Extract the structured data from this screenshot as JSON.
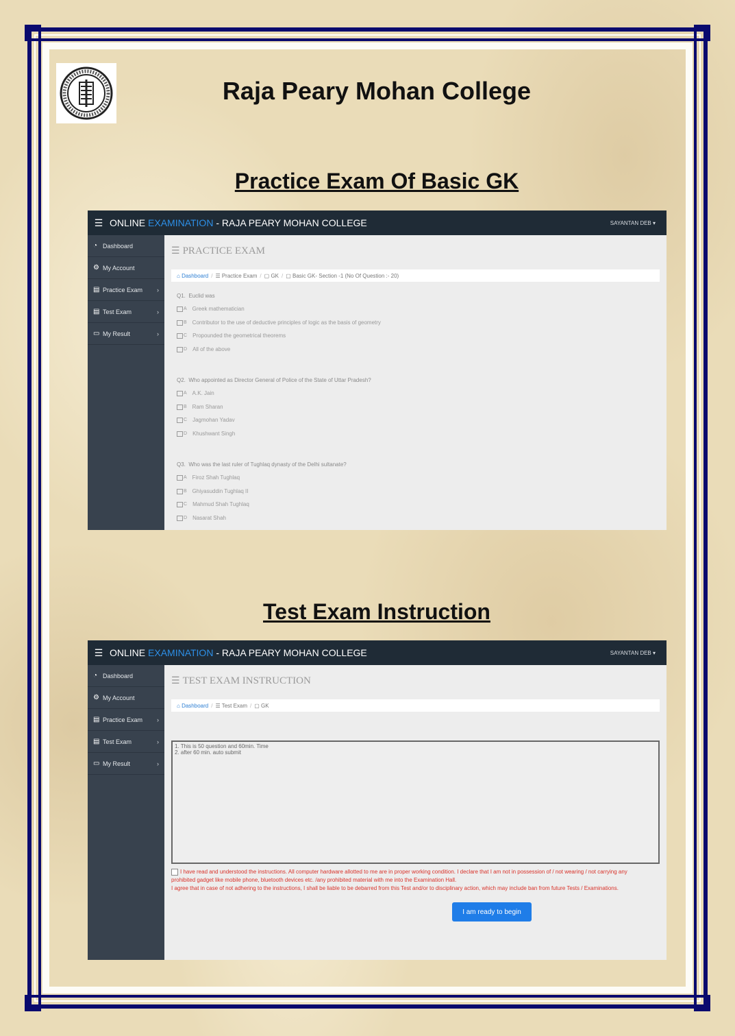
{
  "college_name": "Raja Peary Mohan College",
  "sections": {
    "practice_title": "Practice Exam Of Basic GK",
    "test_title": "Test Exam Instruction"
  },
  "app": {
    "brand_prefix": "ONLINE ",
    "brand_accent": "EXAMINATION",
    "brand_suffix": " - RAJA PEARY MOHAN COLLEGE",
    "user": "SAYANTAN DEB ▾",
    "sidebar": [
      {
        "label": "Dashboard",
        "icon": "dashboard-icon"
      },
      {
        "label": "My Account",
        "icon": "gear-icon"
      },
      {
        "label": "Practice Exam",
        "icon": "list-icon"
      },
      {
        "label": "Test Exam",
        "icon": "list-icon"
      },
      {
        "label": "My Result",
        "icon": "monitor-icon"
      }
    ]
  },
  "practice": {
    "heading": "PRACTICE EXAM",
    "breadcrumb": {
      "home": "Dashboard",
      "c1": "Practice Exam",
      "c2": "GK",
      "c3": "Basic GK- Section -1 (No Of Question :- 20)"
    },
    "questions": [
      {
        "number": "Q1.",
        "text": "Euclid was",
        "options": [
          {
            "letter": "A",
            "text": "Greek mathematician"
          },
          {
            "letter": "B",
            "text": "Contributor to the use of deductive principles of logic as the basis of geometry"
          },
          {
            "letter": "C",
            "text": "Propounded the geometrical theorems"
          },
          {
            "letter": "D",
            "text": "All of the above"
          }
        ]
      },
      {
        "number": "Q2.",
        "text": "Who appointed as Director General of Police of the State of Uttar Pradesh?",
        "options": [
          {
            "letter": "A",
            "text": "A.K. Jain"
          },
          {
            "letter": "B",
            "text": "Ram Sharan"
          },
          {
            "letter": "C",
            "text": "Jagmohan Yadav"
          },
          {
            "letter": "D",
            "text": "Khushwant Singh"
          }
        ]
      },
      {
        "number": "Q3.",
        "text": "Who was the last ruler of Tughlaq dynasty of the Delhi sultanate?",
        "options": [
          {
            "letter": "A",
            "text": "Firoz Shah Tughlaq"
          },
          {
            "letter": "B",
            "text": "Ghiyasuddin Tughlaq II"
          },
          {
            "letter": "C",
            "text": "Mahmud Shah Tughlaq"
          },
          {
            "letter": "D",
            "text": "Nasarat Shah"
          }
        ]
      }
    ]
  },
  "test": {
    "heading": "TEST EXAM INSTRUCTION",
    "breadcrumb": {
      "home": "Dashboard",
      "c1": "Test Exam",
      "c2": "GK"
    },
    "instructions": [
      "1. This is 50 question and 60min. Time",
      "2. after 60 min. auto submit"
    ],
    "declaration_1": "I have read and understood the instructions. All computer hardware allotted to me are in proper working condition. I declare that I am not in possession of / not wearing / not carrying any prohibited gadget like mobile phone, bluetooth devices etc. /any prohibited material with me into the Examination Hall.",
    "declaration_2": "I agree that in case of not adhering to the instructions, I shall be liable to be debarred from this Test and/or to disciplinary action, which may include ban from future Tests / Examinations.",
    "begin_button": "I am ready to begin"
  },
  "colors": {
    "frame": "#0a0a6e",
    "topbar": "#1f2b36",
    "sidebar": "#38424e",
    "accent": "#2d8fe6",
    "warning": "#d9322a",
    "button": "#1f7de8"
  }
}
